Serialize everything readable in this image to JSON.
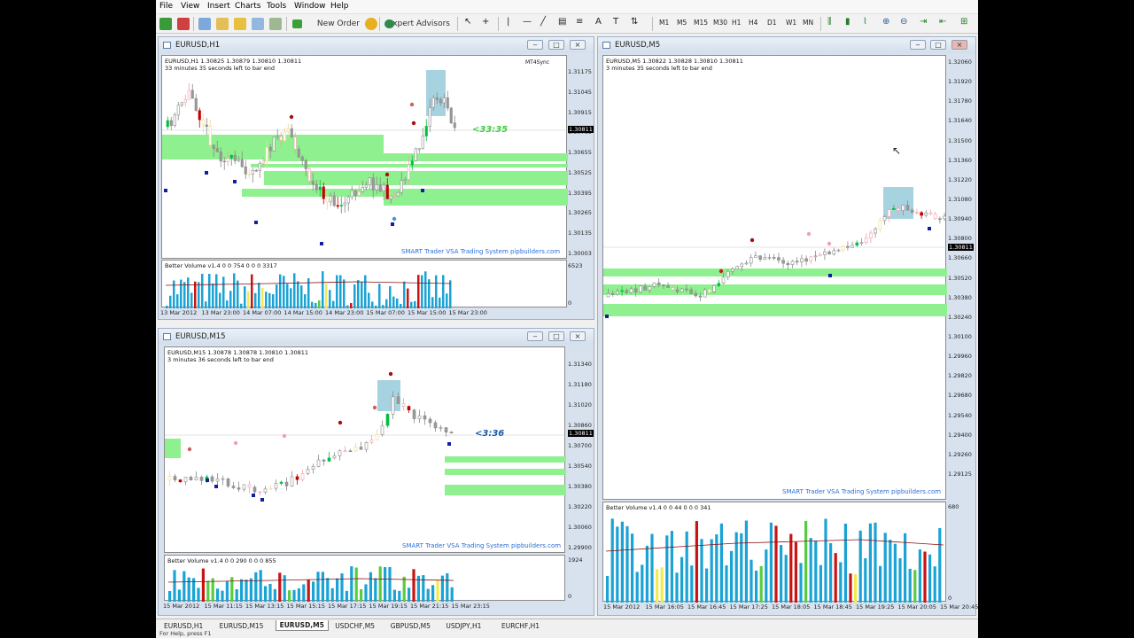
{
  "menu": [
    "File",
    "View",
    "Insert",
    "Charts",
    "Tools",
    "Window",
    "Help"
  ],
  "toolbar": {
    "new_order": "New Order",
    "expert_advisors": "Expert Advisors",
    "timeframes": [
      "M1",
      "M5",
      "M15",
      "M30",
      "H1",
      "H4",
      "D1",
      "W1",
      "MN"
    ]
  },
  "colors": {
    "bull": "#00c040",
    "bear": "#c00000",
    "doji": "#b4b4b4",
    "zone": "#8ef08e",
    "sel": "#a7d3e0",
    "volume": "#1aa3d4",
    "vol_green": "#58cc40",
    "vol_red": "#c81414",
    "vol_yellow": "#f0ec50"
  },
  "brand_text": "SMART Trader VSA Trading System pipbuilders.com",
  "windows": {
    "h1": {
      "title": "EURUSD,H1",
      "info1": "EURUSD,H1  1.30825 1.30879 1.30810 1.30811",
      "info2": "33 minutes 35 seconds left to bar end",
      "sync": "MT4Sync",
      "timer": "<33:35",
      "prices": [
        "1.31175",
        "1.31045",
        "1.30915",
        "1.30785",
        "1.30655",
        "1.30525",
        "1.30395",
        "1.30265",
        "1.30135",
        "1.30003"
      ],
      "current": "1.30811",
      "vol_label": "Better Volume v1.4 0 0 754 0 0 0 3317",
      "vol_scale": [
        "6523",
        "0"
      ],
      "times": [
        "13 Mar 2012",
        "13 Mar 23:00",
        "14 Mar 07:00",
        "14 Mar 15:00",
        "14 Mar 23:00",
        "15 Mar 07:00",
        "15 Mar 15:00",
        "15 Mar 23:00"
      ]
    },
    "m15": {
      "title": "EURUSD,M15",
      "info1": "EURUSD,M15  1.30878 1.30878 1.30810 1.30811",
      "info2": "3 minutes 36 seconds left to bar end",
      "timer": "<3:36",
      "prices": [
        "1.31340",
        "1.31180",
        "1.31020",
        "1.30860",
        "1.30700",
        "1.30540",
        "1.30380",
        "1.30220",
        "1.30060",
        "1.29900"
      ],
      "current": "1.30811",
      "vol_label": "Better Volume v1.4 0 0 290 0 0 0 855",
      "vol_scale": [
        "1924",
        "0"
      ],
      "times": [
        "15 Mar 2012",
        "15 Mar 11:15",
        "15 Mar 13:15",
        "15 Mar 15:15",
        "15 Mar 17:15",
        "15 Mar 19:15",
        "15 Mar 21:15",
        "15 Mar 23:15"
      ]
    },
    "m5": {
      "title": "EURUSD,M5",
      "info1": "EURUSD,M5  1.30822 1.30828 1.30810 1.30811",
      "info2": "3 minutes 35 seconds left to bar end",
      "prices": [
        "1.32060",
        "1.31920",
        "1.31780",
        "1.31640",
        "1.31500",
        "1.31360",
        "1.31220",
        "1.31080",
        "1.30940",
        "1.30800",
        "1.30660",
        "1.30520",
        "1.30380",
        "1.30240",
        "1.30100",
        "1.29960",
        "1.29820",
        "1.29680",
        "1.29540",
        "1.29400",
        "1.29260",
        "1.29125"
      ],
      "current": "1.30811",
      "vol_label": "Better Volume v1.4 0 0 44 0 0 0 341",
      "vol_scale": [
        "680",
        "0"
      ],
      "times": [
        "15 Mar 2012",
        "15 Mar 16:05",
        "15 Mar 16:45",
        "15 Mar 17:25",
        "15 Mar 18:05",
        "15 Mar 18:45",
        "15 Mar 19:25",
        "15 Mar 20:05",
        "15 Mar 20:45"
      ]
    }
  },
  "tabs": [
    "EURUSD,H1",
    "EURUSD,M15",
    "EURUSD,M5",
    "USDCHF,M5",
    "GBPUSD,M5",
    "USDJPY,H1",
    "EURCHF,H1"
  ],
  "active_tab": 2
}
